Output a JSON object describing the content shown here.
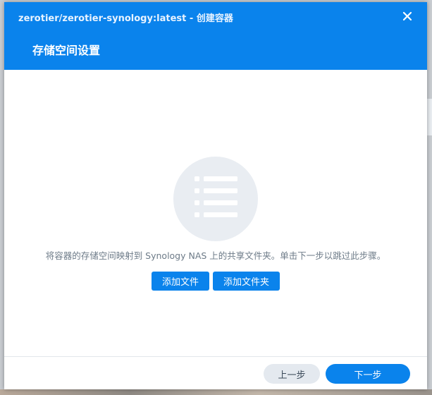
{
  "window": {
    "title": "zerotier/zerotier-synology:latest - 创建容器",
    "close_icon": "close-icon"
  },
  "step": {
    "title": "存储空间设置"
  },
  "content": {
    "icon": "list-icon",
    "description": "将容器的存储空间映射到 Synology NAS 上的共享文件夹。单击下一步以跳过此步骤。",
    "add_file_label": "添加文件",
    "add_folder_label": "添加文件夹"
  },
  "footer": {
    "prev_label": "上一步",
    "next_label": "下一步"
  },
  "colors": {
    "accent": "#0a83ec",
    "secondary_button": "#e4e9ef",
    "icon_circle": "#e9edf2",
    "description_text": "#6d7b88"
  }
}
